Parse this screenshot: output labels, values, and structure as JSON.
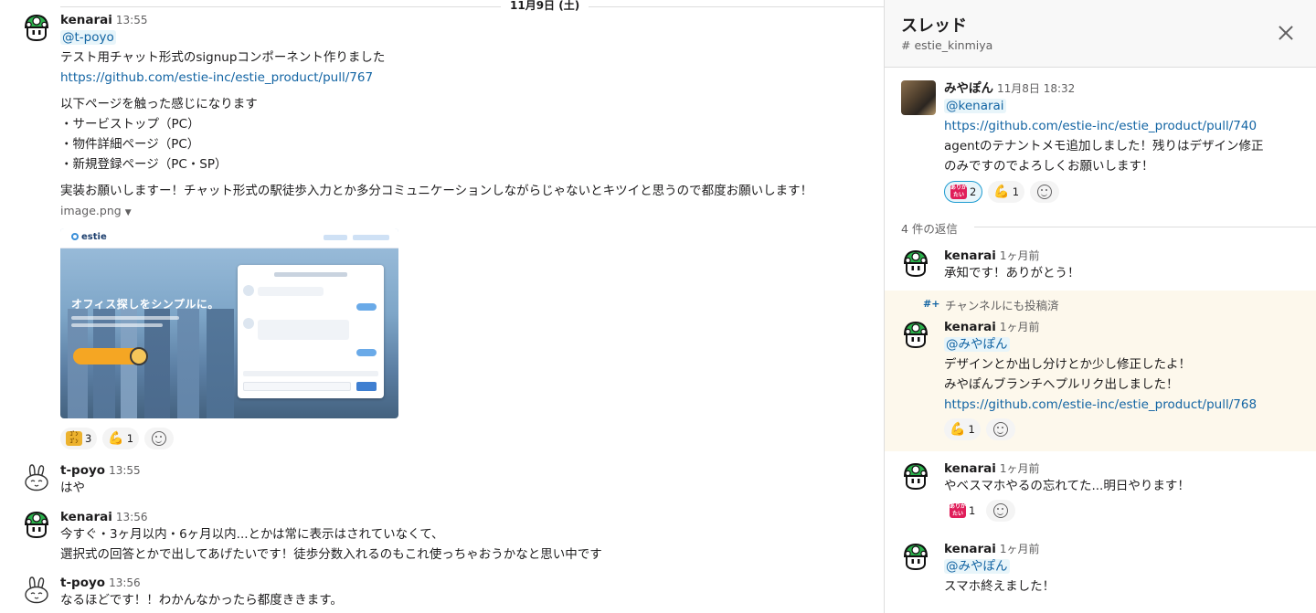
{
  "main": {
    "date_divider": "11月9日 (土)",
    "messages": [
      {
        "author": "kenarai",
        "time": "13:55",
        "lines": [
          "@t-poyo",
          "テスト用チャット形式のsignupコンポーネント作りました",
          "https://github.com/estie-inc/estie_product/pull/767",
          "以下ページを触った感じになります",
          "・サービストップ（PC）",
          "・物件詳細ページ（PC）",
          "・新規登録ページ（PC・SP）",
          "実装お願いしますー！チャット形式の駅徒歩入力とか多分コミュニケーションしながらじゃないとキツイと思うので都度お願いします！"
        ],
        "file_name": "image.png",
        "attachment": {
          "brand": "estie",
          "headline": "オフィス探しをシンプルに。"
        },
        "reactions": [
          {
            "icon": "coin-stack-emoji",
            "count": "3"
          },
          {
            "icon": "flexed-biceps-emoji",
            "count": "1"
          }
        ]
      },
      {
        "author": "t-poyo",
        "time": "13:55",
        "lines": [
          "はや"
        ]
      },
      {
        "author": "kenarai",
        "time": "13:56",
        "lines": [
          "今すぐ・3ヶ月以内・6ヶ月以内...とかは常に表示はされていなくて、",
          "選択式の回答とかで出してあげたいです！徒歩分数入れるのもこれ使っちゃおうかなと思い中です"
        ]
      },
      {
        "author": "t-poyo",
        "time": "13:56",
        "lines": [
          "なるほどです！！わかんなかったら都度ききます。"
        ]
      }
    ]
  },
  "thread": {
    "title": "スレッド",
    "channel": "# estie_kinmiya",
    "parent": {
      "author": "みやぽん",
      "time": "11月8日 18:32",
      "lines": [
        "@kenarai",
        "https://github.com/estie-inc/estie_product/pull/740",
        "agentのテナントメモ追加しました！残りはデザイン修正",
        "のみですのでよろしくお願いします！"
      ],
      "reactions": [
        {
          "icon": "arigatai-emoji",
          "label": "ありがたい",
          "count": "2"
        },
        {
          "icon": "flexed-biceps-emoji",
          "count": "1"
        }
      ]
    },
    "replies_label": "4 件の返信",
    "replies": [
      {
        "author": "kenarai",
        "time": "1ヶ月前",
        "lines": [
          "承知です！ありがとう！"
        ]
      },
      {
        "also_sent": "チャンネルにも投稿済",
        "author": "kenarai",
        "time": "1ヶ月前",
        "lines": [
          "@みやぽん",
          "デザインとか出し分けとか少し修正したよ！",
          "みやぽんブランチへプルリク出しました！",
          "https://github.com/estie-inc/estie_product/pull/768"
        ],
        "reactions": [
          {
            "icon": "flexed-biceps-emoji",
            "count": "1"
          }
        ]
      },
      {
        "author": "kenarai",
        "time": "1ヶ月前",
        "lines": [
          "やベスマホやるの忘れてた...明日やります！"
        ],
        "reactions": [
          {
            "icon": "arigatai-emoji",
            "label": "ありがたい",
            "count": "1"
          }
        ]
      },
      {
        "author": "kenarai",
        "time": "1ヶ月前",
        "lines": [
          "@みやぽん",
          "スマホ終えました！"
        ]
      }
    ]
  },
  "colors": {
    "link": "#1264a3",
    "mention_bg": "#e8f5fa",
    "highlight_bg": "#fdf8ec",
    "arigatai": "#e01e5a"
  }
}
